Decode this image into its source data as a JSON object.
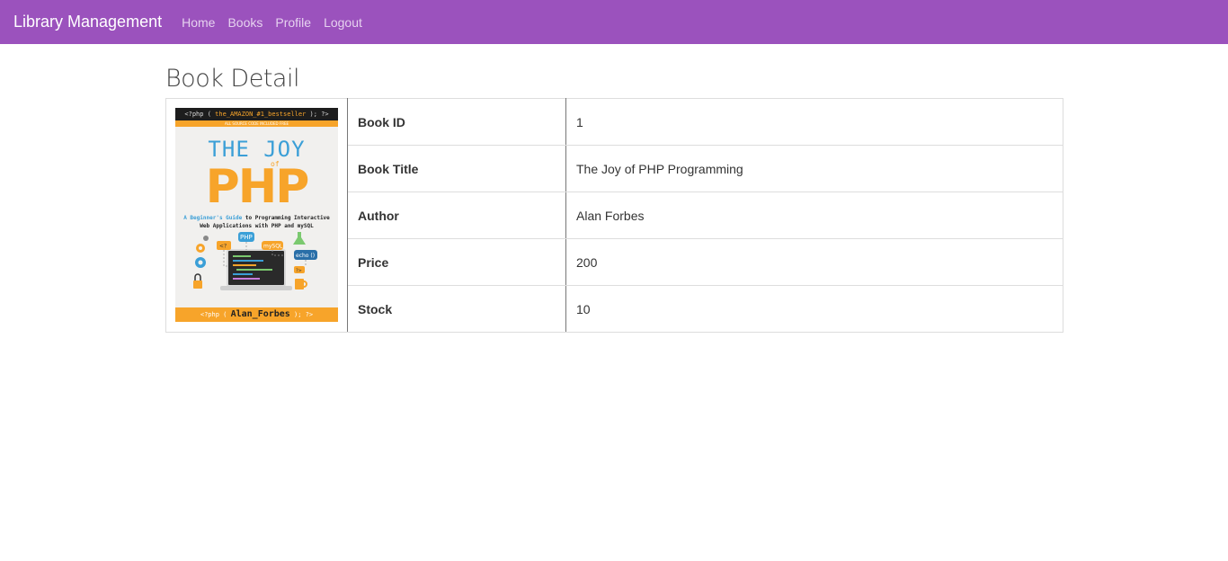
{
  "navbar": {
    "brand": "Library Management",
    "links": [
      "Home",
      "Books",
      "Profile",
      "Logout"
    ]
  },
  "page": {
    "title": "Book Detail"
  },
  "book": {
    "rows": [
      {
        "label": "Book ID",
        "value": "1"
      },
      {
        "label": "Book Title",
        "value": "The Joy of PHP Programming"
      },
      {
        "label": "Author",
        "value": "Alan Forbes"
      },
      {
        "label": "Price",
        "value": "200"
      },
      {
        "label": "Stock",
        "value": "10"
      }
    ],
    "cover": {
      "top_code_prefix": "<?php (",
      "top_code_highlight": "the_AMAZON_#1_bestseller",
      "top_code_suffix": "); ?>",
      "strip_text": "ALL SOURCE CODE INCLUDED FREE",
      "title_joy": "THE JOY",
      "title_of": "of",
      "title_php": "PHP",
      "subtitle_highlight": "A Beginner's Guide",
      "subtitle_rest": "to Programming Interactive Web Applications with PHP and mySQL",
      "bottom_prefix": "<?php (",
      "bottom_author": "Alan_Forbes",
      "bottom_suffix": "); ?>",
      "colors": {
        "orange": "#f7a42a",
        "blue": "#3b9fd7",
        "dark": "#1d1d1d"
      }
    }
  },
  "colors": {
    "navbar": "#9b52bd"
  }
}
